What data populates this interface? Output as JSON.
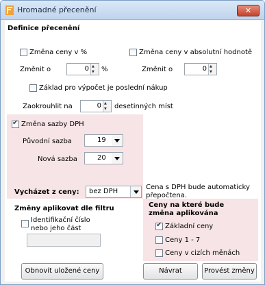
{
  "window": {
    "title": "Hromadné přecenění",
    "close_glyph": "✕"
  },
  "section_definition": {
    "title": "Definice přecenění"
  },
  "percent_change": {
    "label": "Změna ceny v %",
    "checked": false,
    "change_label": "Změnit o",
    "value": "0",
    "unit": "%"
  },
  "absolute_change": {
    "label": "Změna ceny v absolutní hodnotě",
    "checked": false,
    "change_label": "Změnit o",
    "value": "0"
  },
  "last_purchase": {
    "label": "Základ pro výpočet je poslední nákup",
    "checked": false
  },
  "rounding": {
    "label": "Zaokrouhlit na",
    "value": "0",
    "suffix": "desetinných míst"
  },
  "vat_change": {
    "label": "Změna sazby DPH",
    "checked": true,
    "original_label": "Původní sazba",
    "original_value": "19",
    "new_label": "Nová sazba",
    "new_value": "20"
  },
  "base": {
    "label": "Vycházet z ceny:",
    "value": "bez DPH",
    "note_line1": "Cena s DPH bude automaticky",
    "note_line2": "přepočtena."
  },
  "filter": {
    "title": "Změny aplikovat dle filtru",
    "id_label_line1": "Identifikační číslo",
    "id_label_line2": "nebo jeho část",
    "id_checked": false,
    "id_value": ""
  },
  "prices": {
    "title_line1": "Ceny na které bude",
    "title_line2": "změna aplikována",
    "items": [
      {
        "label": "Základní ceny",
        "checked": true
      },
      {
        "label": "Ceny 1 - 7",
        "checked": false
      },
      {
        "label": "Ceny v cizích měnách",
        "checked": false
      }
    ]
  },
  "buttons": {
    "reload": "Obnovit uložené ceny",
    "back": "Návrat",
    "apply": "Provést změny"
  }
}
